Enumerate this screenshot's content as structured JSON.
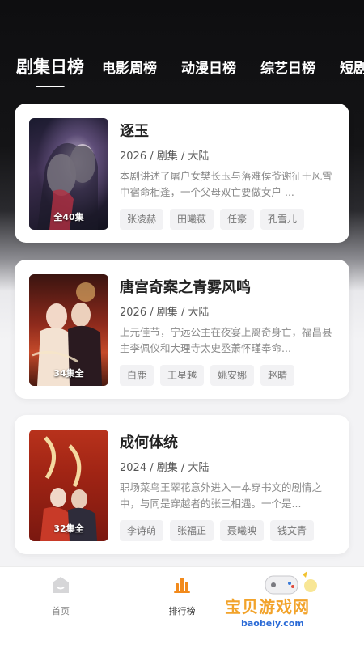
{
  "tabs": [
    {
      "label": "剧集日榜",
      "active": true
    },
    {
      "label": "电影周榜",
      "active": false
    },
    {
      "label": "动漫日榜",
      "active": false
    },
    {
      "label": "综艺日榜",
      "active": false
    },
    {
      "label": "短剧",
      "active": false
    }
  ],
  "cards": [
    {
      "title": "逐玉",
      "meta": "2026 / 剧集 / 大陆",
      "description": "本剧讲述了屠户女樊长玉与落难侯爷谢征于风雪中宿命相逢，一个父母双亡要做女户 ...",
      "episodes_badge": "全40集",
      "tags": [
        "张凌赫",
        "田曦薇",
        "任豪",
        "孔雪儿"
      ]
    },
    {
      "title": "唐宫奇案之青雾风鸣",
      "meta": "2026 / 剧集 / 大陆",
      "description": "上元佳节，宁远公主在夜宴上离奇身亡，福昌县主李佩仪和大理寺太史丞萧怀瑾奉命...",
      "episodes_badge": "34集全",
      "tags": [
        "白鹿",
        "王星越",
        "姚安娜",
        "赵晴"
      ]
    },
    {
      "title": "成何体统",
      "meta": "2024 / 剧集 / 大陆",
      "description": "职场菜鸟王翠花意外进入一本穿书文的剧情之中，与同是穿越者的张三相遇。一个是...",
      "episodes_badge": "32集全",
      "tags": [
        "李诗萌",
        "张福正",
        "聂曦映",
        "钱文青"
      ]
    }
  ],
  "bottom_nav": {
    "home_label": "首页",
    "rank_label": "排行榜"
  },
  "watermark": {
    "title": "宝贝游戏网",
    "url": "baobeiy.com"
  },
  "colors": {
    "accent": "#f28a1c",
    "card_bg": "#ffffff",
    "tag_bg": "#f2f2f4"
  }
}
